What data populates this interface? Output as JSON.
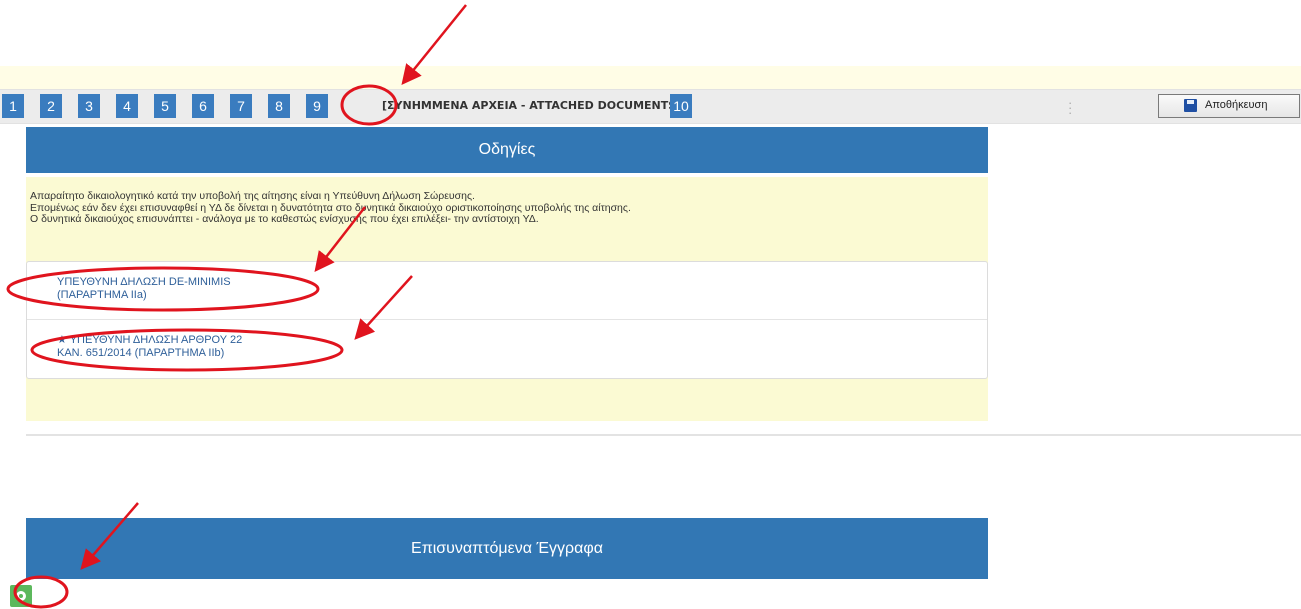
{
  "top_note": "",
  "tabs": [
    "1",
    "2",
    "3",
    "4",
    "5",
    "6",
    "7",
    "8",
    "9",
    "10"
  ],
  "current_tab_label": "[ΣΥΝΗΜΜΕΝΑ ΑΡΧΕΙΑ - ATTACHED DOCUMENTS]",
  "save_label": "Αποθήκευση",
  "instructions": {
    "title": "Οδηγίες",
    "lines": [
      "Απαραίτητο δικαιολογητικό κατά την υποβολή της αίτησης είναι η Υπεύθυνη Δήλωση Σώρευσης.",
      "Επομένως εάν δεν έχει επισυναφθεί η ΥΔ δε δίνεται η δυνατότητα στο δυνητικά δικαιούχο οριστικοποίησης υποβολής της αίτησης.",
      "Ο δυνητικά δικαιούχος επισυνάπτει - ανάλογα με το καθεστώς ενίσχυσης που έχει επιλέξει- την αντίστοιχη ΥΔ."
    ],
    "docs": [
      {
        "line1": "ΥΠΕΥΘΥΝΗ ΔΗΛΩΣΗ DE-MINIMIS",
        "line2": "(ΠΑΡΑΡΤΗΜΑ IIa)",
        "starred": false
      },
      {
        "line1": "★ ΥΠΕΥΘΥΝΗ ΔΗΛΩΣΗ ΑΡΘΡΟΥ 22",
        "line2": "ΚΑΝ. 651/2014 (ΠΑΡΑΡΤΗΜΑ IIb)",
        "starred": true
      }
    ]
  },
  "attachments": {
    "title": "Επισυναπτόμενα Έγγραφα"
  },
  "colors": {
    "header_blue": "#3277b4",
    "tab_blue": "#3a7cbf",
    "instructions_bg": "#fbfad3",
    "annotation_red": "#e0141e",
    "add_green": "#5cb85c"
  },
  "icons": {
    "save": "floppy-disk-icon",
    "add": "add-circle-icon"
  }
}
